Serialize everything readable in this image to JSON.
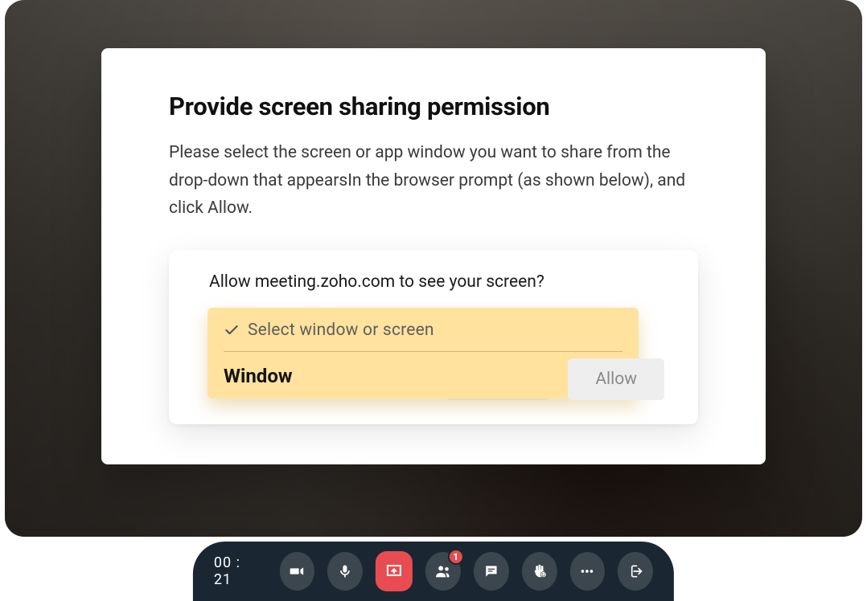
{
  "modal": {
    "title": "Provide screen sharing permission",
    "description": "Please select the screen or app window you want to share from the drop-down that appearsIn the browser prompt (as shown below), and click Allow.",
    "prompt": {
      "question": "Allow meeting.zoho.com to see your screen?",
      "dropdown_label": "Select window or screen",
      "dropdown_option": "Window",
      "allow_button": "Allow"
    }
  },
  "toolbar": {
    "timer": "00 : 21",
    "participants_badge": "1"
  }
}
